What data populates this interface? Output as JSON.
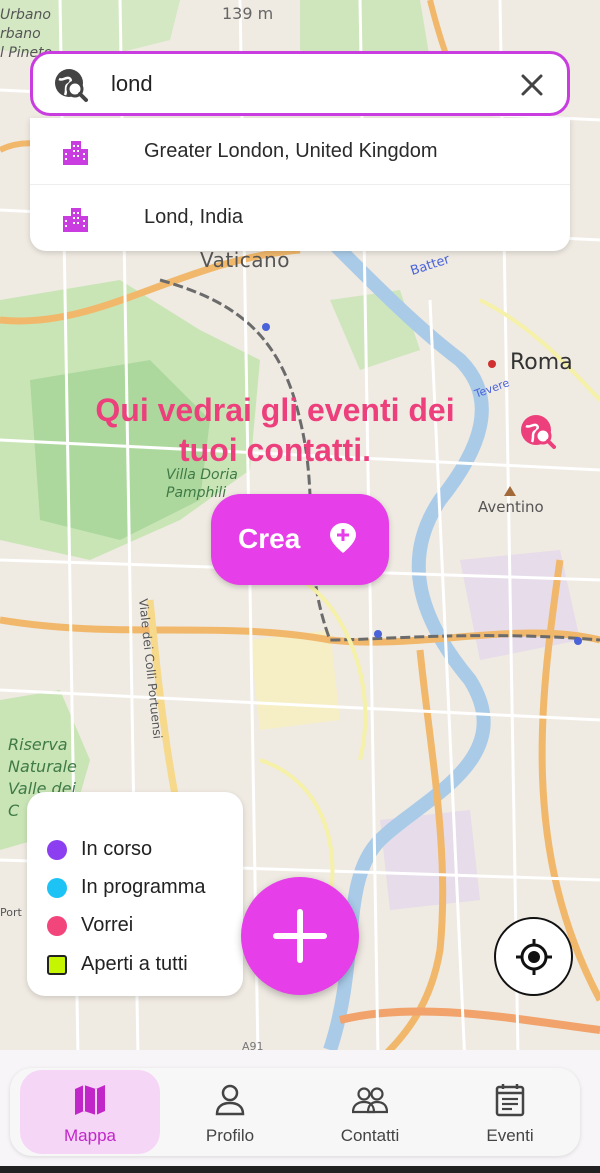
{
  "search": {
    "query": "lond",
    "suggestions": [
      {
        "label": "Greater London, United Kingdom",
        "icon": "city-icon"
      },
      {
        "label": "Lond, India",
        "icon": "city-icon"
      }
    ]
  },
  "map": {
    "labels": {
      "vaticano": "Vaticano",
      "roma": "Roma",
      "aventino": "Aventino",
      "villa_doria": "Villa Doria\nPamphili",
      "riserva": "Riserva\nNaturale\nValle dei\nC",
      "viale": "Viale dei Colli Portuensi",
      "top_left": "Urbano\nrbano\nl Pineto",
      "elevation": "139 m",
      "porto": "Port",
      "tevere": "Tevere",
      "batteria": "Batter",
      "a91": "A91"
    }
  },
  "empty_state": {
    "message_line1": "Qui vedrai gli eventi dei",
    "message_line2": "tuoi contatti.",
    "create_label": "Crea"
  },
  "legend": {
    "items": [
      {
        "label": "In corso",
        "color": "#8b3ff0",
        "shape": "dot"
      },
      {
        "label": "In programma",
        "color": "#1ec3f5",
        "shape": "dot"
      },
      {
        "label": "Vorrei",
        "color": "#f2457c",
        "shape": "dot"
      },
      {
        "label": "Aperti a tutti",
        "color": "#c5f500",
        "shape": "square"
      }
    ]
  },
  "nav": {
    "items": [
      {
        "label": "Mappa",
        "icon": "map-icon",
        "active": true
      },
      {
        "label": "Profilo",
        "icon": "person-icon",
        "active": false
      },
      {
        "label": "Contatti",
        "icon": "people-icon",
        "active": false
      },
      {
        "label": "Eventi",
        "icon": "calendar-icon",
        "active": false
      }
    ]
  },
  "colors": {
    "accent": "#e63ee8",
    "message": "#ec3f7c",
    "active_nav_bg": "#f6d6f6"
  }
}
